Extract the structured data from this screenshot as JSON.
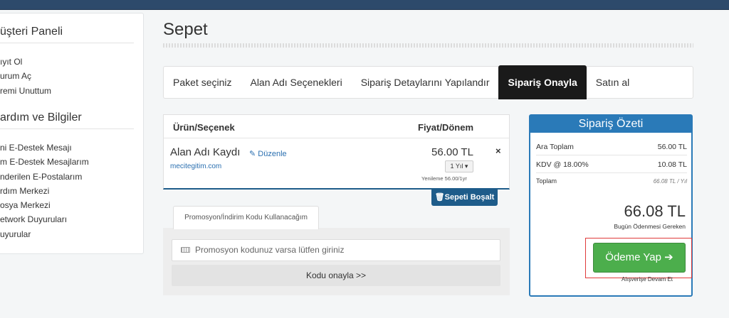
{
  "sidebar": {
    "section1_title": "üşteri Paneli",
    "section1_links": [
      "ıyıt Ol",
      "urum Aç",
      "remi Unuttum"
    ],
    "section2_title": "ardım ve Bilgiler",
    "section2_links": [
      "ni E-Destek Mesajı",
      "m E-Destek Mesajlarım",
      "nderilen E-Postalarım",
      "rdım Merkezi",
      "osya Merkezi",
      "etwork Duyuruları",
      "uyurular"
    ]
  },
  "page": {
    "title": "Sepet"
  },
  "steps": [
    {
      "label": "Paket seçiniz",
      "active": false
    },
    {
      "label": "Alan Adı Seçenekleri",
      "active": false
    },
    {
      "label": "Sipariş Detaylarını Yapılandır",
      "active": false
    },
    {
      "label": "Sipariş Onayla",
      "active": true
    },
    {
      "label": "Satın al",
      "active": false
    }
  ],
  "cart": {
    "col_product": "Ürün/Seçenek",
    "col_price": "Fiyat/Dönem",
    "item": {
      "name": "Alan Adı Kaydı",
      "edit": "Düzenle",
      "domain": "mecitegitim.com",
      "price": "56.00 TL",
      "period": "1 Yıl",
      "renewal": "Yenileme 56.00/1yr",
      "remove": "×"
    },
    "empty_button": "Sepeti Boşalt"
  },
  "promo": {
    "tab_label": "Promosyon/İndirim Kodu Kullanacağım",
    "input_placeholder": "Promosyon kodunuz varsa lütfen giriniz",
    "apply_button": "Kodu onayla >>"
  },
  "summary": {
    "title": "Sipariş Özeti",
    "subtotal_label": "Ara Toplam",
    "subtotal_value": "56.00 TL",
    "tax_label": "KDV @ 18.00%",
    "tax_value": "10.08 TL",
    "total_label": "Toplam",
    "total_small": "66.08 TL / Yıl",
    "total_big": "66.08 TL",
    "today_label": "Bugün Ödenmesi Gereken",
    "pay_button": "Ödeme Yap",
    "pay_arrow": "➔",
    "continue": "Alışverişe Devam Et"
  },
  "colors": {
    "topbar": "#2d4a6b",
    "accent_blue": "#2a7ab8",
    "pay_green": "#4cae4c",
    "highlight_red": "#e03a3a"
  }
}
